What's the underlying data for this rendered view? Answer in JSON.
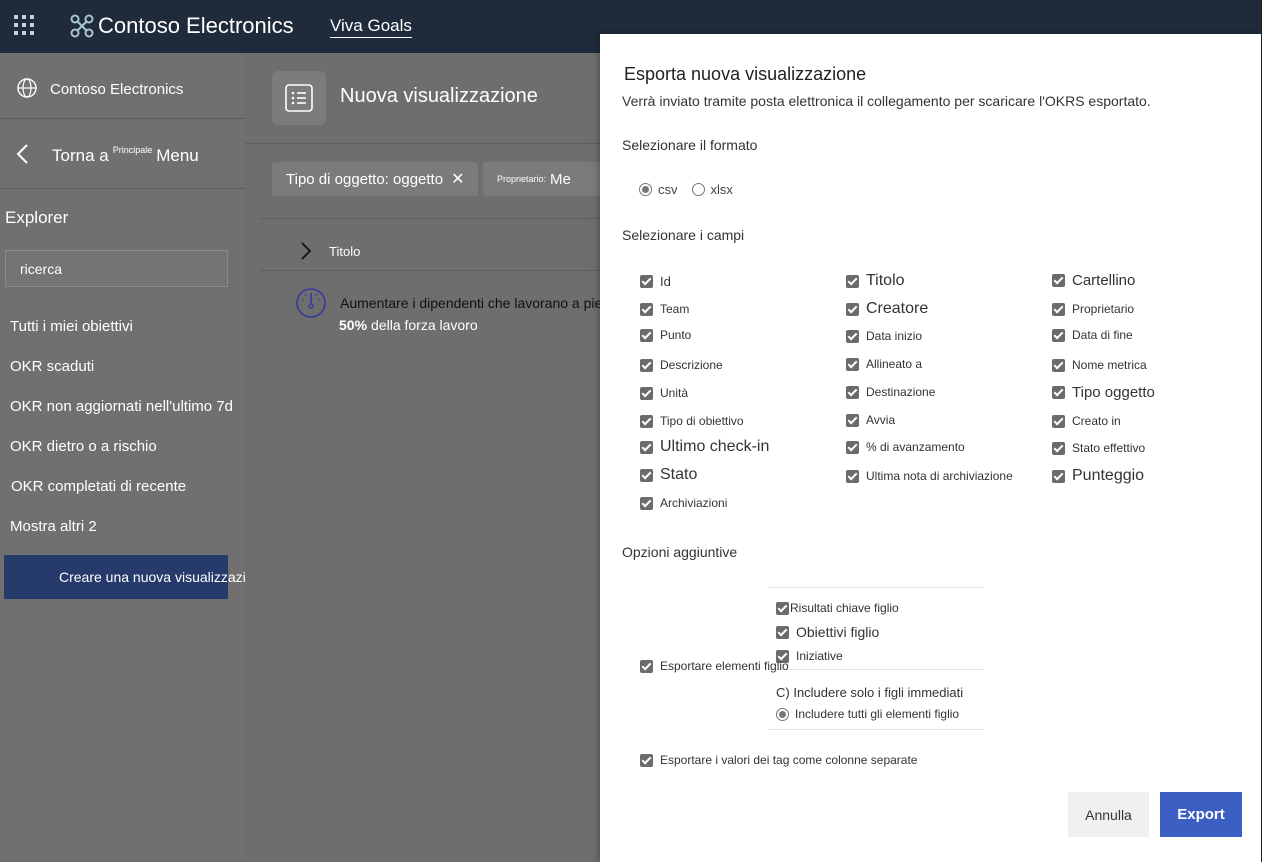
{
  "topbar": {
    "brand_name": "Contoso Electronics",
    "product_name": "Viva Goals"
  },
  "sidebar": {
    "org_name": "Contoso Electronics",
    "back_prefix": "Torna a",
    "back_sup": "Principale",
    "back_suffix": "Menu",
    "explorer_title": "Explorer",
    "search_placeholder": "ricerca",
    "items": [
      "Tutti i miei obiettivi",
      "OKR scaduti",
      "OKR non aggiornati nell'ultimo 7d",
      "OKR dietro o a rischio",
      "OKR completati di recente",
      "Mostra altri 2"
    ],
    "create_button": "Creare una nuova visualizzazione"
  },
  "main": {
    "view_title": "Nuova visualizzazione",
    "chip_type": "Tipo di oggetto: oggetto",
    "chip_owner_small": "Proprietario:",
    "chip_owner_value": "Me",
    "column_title": "Titolo",
    "okr_title": "Aumentare i dipendenti che lavorano a pieno tim",
    "okr_percent": "50%",
    "okr_progress_text": "della forza lavoro"
  },
  "panel": {
    "title": "Esporta nuova visualizzazione",
    "subtitle": "Verrà inviato tramite posta elettronica il collegamento per scaricare l'OKRS esportato.",
    "format_label": "Selezionare il formato",
    "format_options": [
      "csv",
      "xlsx"
    ],
    "format_selected": "csv",
    "fields_label": "Selezionare i campi",
    "fields": {
      "col1": [
        "Id",
        "Team",
        "Punto",
        "Descrizione",
        "Unità",
        "Tipo di obiettivo",
        "Ultimo check-in",
        "Stato",
        "Archiviazioni"
      ],
      "col2": [
        "Titolo",
        "Creatore",
        "Data inizio",
        "Allineato a",
        "Destinazione",
        "Avvia",
        "% di avanzamento",
        "Ultima nota di archiviazione"
      ],
      "col3": [
        "Cartellino",
        "Proprietario",
        "Data di fine",
        "Nome metrica",
        "Tipo oggetto",
        "Creato in",
        "Stato effettivo",
        "Punteggio"
      ]
    },
    "options_label": "Opzioni aggiuntive",
    "child_options": [
      "Risultati chiave figlio",
      "Obiettivi figlio",
      "Iniziative"
    ],
    "export_children": "Esportare elementi figlio",
    "child_scope_immediate": "C) Includere solo i figli immediati",
    "child_scope_all": "Includere tutti gli elementi figlio",
    "export_tags": "Esportare i valori dei tag come colonne separate",
    "cancel_label": "Annulla",
    "export_label": "Export"
  }
}
